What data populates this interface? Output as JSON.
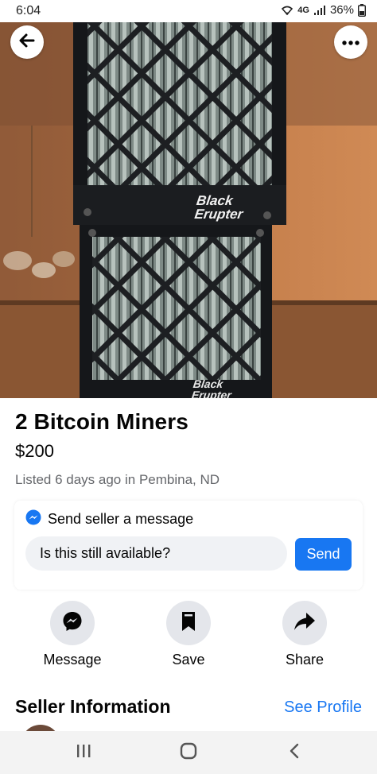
{
  "status_bar": {
    "time": "6:04",
    "network": "4G",
    "battery": "36%"
  },
  "photo": {
    "brand_text_top": "Black Erupter",
    "brand_text_bottom": "Black Erupter"
  },
  "listing": {
    "title": "2 Bitcoin Miners",
    "price": "$200",
    "listed": "Listed 6 days ago in Pembina, ND"
  },
  "message_card": {
    "header": "Send seller a message",
    "input_value": "Is this still available?",
    "send_label": "Send"
  },
  "actions": [
    {
      "label": "Message",
      "icon": "messenger-icon"
    },
    {
      "label": "Save",
      "icon": "bookmark-icon"
    },
    {
      "label": "Share",
      "icon": "share-arrow-icon"
    }
  ],
  "seller": {
    "title": "Seller Information",
    "see_profile": "See Profile"
  },
  "colors": {
    "accent": "#1877f2",
    "secondary_text": "#65676b",
    "icon_bg": "#e4e6eb"
  }
}
